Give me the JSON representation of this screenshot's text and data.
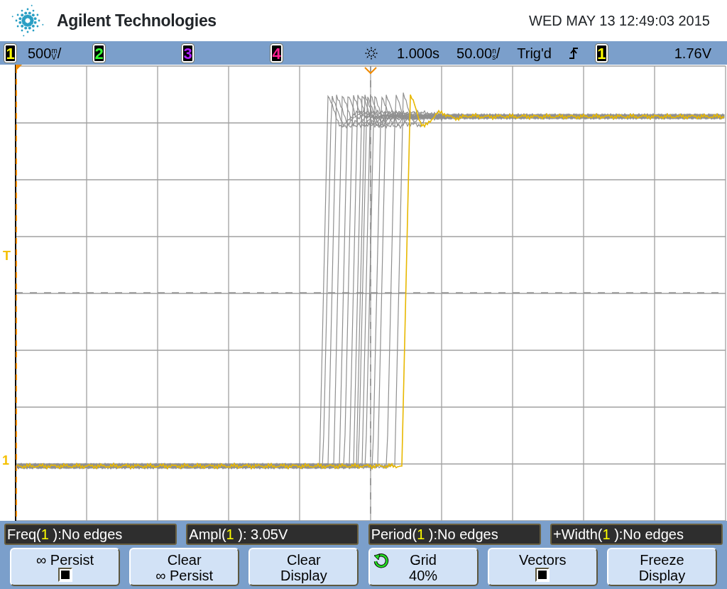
{
  "header": {
    "brand": "Agilent Technologies",
    "datetime": "WED MAY 13 12:49:03 2015"
  },
  "status_bar": {
    "channels": [
      {
        "label": "1",
        "scale": "500",
        "unit_top": "m",
        "unit_bottom": "V",
        "suffix": "/"
      },
      {
        "label": "2"
      },
      {
        "label": "3"
      },
      {
        "label": "4"
      }
    ],
    "time_reference": "1.000s",
    "time_scale": "50.00",
    "time_unit_top": "n",
    "time_unit_bottom": "s",
    "time_suffix": "/",
    "trigger_status": "Trig'd",
    "trigger_channel": "1",
    "trigger_level": "1.76V"
  },
  "display": {
    "trigger_marker": "T",
    "channel_marker": "1"
  },
  "measurements": [
    {
      "before": "Freq(",
      "channel": "1",
      "after": " ):No edges"
    },
    {
      "before": "Ampl(",
      "channel": "1",
      "after": " ): 3.05V"
    },
    {
      "before": "Period(",
      "channel": "1",
      "after": " ):No edges"
    },
    {
      "before": "+Width(",
      "channel": "1",
      "after": " ):No edges"
    }
  ],
  "softkeys": [
    {
      "kind": "checkbox",
      "lines": [
        "∞ Persist"
      ],
      "checked": true
    },
    {
      "kind": "plain",
      "lines": [
        "Clear",
        "∞ Persist"
      ]
    },
    {
      "kind": "plain",
      "lines": [
        "Clear",
        "Display"
      ]
    },
    {
      "kind": "cycle",
      "lines": [
        "Grid",
        "40%"
      ]
    },
    {
      "kind": "checkbox",
      "lines": [
        "Vectors"
      ],
      "checked": true
    },
    {
      "kind": "plain",
      "lines": [
        "Freeze",
        "Display"
      ]
    }
  ]
}
